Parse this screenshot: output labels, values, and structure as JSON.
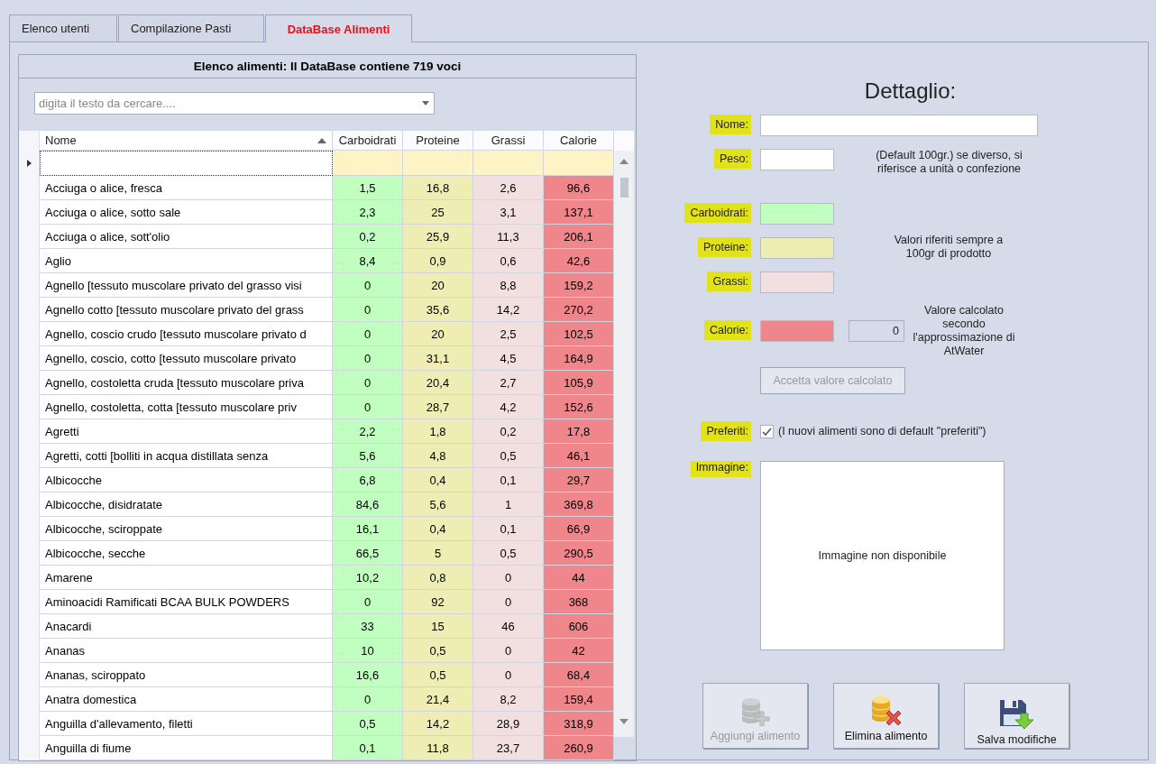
{
  "tabs": [
    {
      "label": "Elenco utenti",
      "selected": false
    },
    {
      "label": "Compilazione Pasti",
      "selected": false
    },
    {
      "label": "DataBase Alimenti",
      "selected": true
    }
  ],
  "list_panel": {
    "title": "Elenco alimenti:  Il DataBase contiene 719 voci",
    "search": {
      "placeholder": "digita il testo da cercare...."
    },
    "table": {
      "columns": [
        {
          "label": "Nome",
          "sorted": true
        },
        {
          "label": "Carboidrati",
          "color": "#c0ffc0"
        },
        {
          "label": "Proteine",
          "color": "#eeeeb4"
        },
        {
          "label": "Grassi",
          "color": "#f2dfe0"
        },
        {
          "label": "Calorie",
          "color": "#ee868c"
        }
      ],
      "new_row": {
        "current": true
      },
      "rows": [
        [
          "Acciuga o alice, fresca",
          "1,5",
          "16,8",
          "2,6",
          "96,6"
        ],
        [
          "Acciuga o alice, sotto sale",
          "2,3",
          "25",
          "3,1",
          "137,1"
        ],
        [
          "Acciuga o alice, sott'olio",
          "0,2",
          "25,9",
          "11,3",
          "206,1"
        ],
        [
          "Aglio",
          "8,4",
          "0,9",
          "0,6",
          "42,6"
        ],
        [
          "Agnello [tessuto muscolare privato del grasso visi",
          "0",
          "20",
          "8,8",
          "159,2"
        ],
        [
          "Agnello cotto [tessuto muscolare privato del grass",
          "0",
          "35,6",
          "14,2",
          "270,2"
        ],
        [
          "Agnello, coscio crudo [tessuto muscolare privato d",
          "0",
          "20",
          "2,5",
          "102,5"
        ],
        [
          "Agnello, coscio, cotto [tessuto muscolare privato",
          "0",
          "31,1",
          "4,5",
          "164,9"
        ],
        [
          "Agnello, costoletta cruda [tessuto muscolare priva",
          "0",
          "20,4",
          "2,7",
          "105,9"
        ],
        [
          "Agnello, costoletta, cotta [tessuto muscolare priv",
          "0",
          "28,7",
          "4,2",
          "152,6"
        ],
        [
          "Agretti",
          "2,2",
          "1,8",
          "0,2",
          "17,8"
        ],
        [
          "Agretti, cotti [bolliti in acqua distillata senza",
          "5,6",
          "4,8",
          "0,5",
          "46,1"
        ],
        [
          "Albicocche",
          "6,8",
          "0,4",
          "0,1",
          "29,7"
        ],
        [
          "Albicocche, disidratate",
          "84,6",
          "5,6",
          "1",
          "369,8"
        ],
        [
          "Albicocche, sciroppate",
          "16,1",
          "0,4",
          "0,1",
          "66,9"
        ],
        [
          "Albicocche, secche",
          "66,5",
          "5",
          "0,5",
          "290,5"
        ],
        [
          "Amarene",
          "10,2",
          "0,8",
          "0",
          "44"
        ],
        [
          "Aminoacidi Ramificati BCAA BULK POWDERS",
          "0",
          "92",
          "0",
          "368"
        ],
        [
          "Anacardi",
          "33",
          "15",
          "46",
          "606"
        ],
        [
          "Ananas",
          "10",
          "0,5",
          "0",
          "42"
        ],
        [
          "Ananas, sciroppato",
          "16,6",
          "0,5",
          "0",
          "68,4"
        ],
        [
          "Anatra domestica",
          "0",
          "21,4",
          "8,2",
          "159,4"
        ],
        [
          "Anguilla d'allevamento, filetti",
          "0,5",
          "14,2",
          "28,9",
          "318,9"
        ],
        [
          "Anguilla di fiume",
          "0,1",
          "11,8",
          "23,7",
          "260,9"
        ]
      ]
    }
  },
  "detail": {
    "title": "Dettaglio:",
    "fields": [
      {
        "kind": "wide",
        "label": "Nome:",
        "highlighted": true
      },
      {
        "kind": "short",
        "label": "Peso:",
        "highlighted": true,
        "note": "(Default 100gr.) se diverso, si riferisce a unità o confezione"
      },
      {
        "kind": "short",
        "label": "Carboidrati:",
        "highlighted": true,
        "color": "#c0ffc0"
      },
      {
        "kind": "short",
        "label": "Proteine:",
        "highlighted": true,
        "color": "#eeeeb4",
        "note": "Valori riferiti sempre a 100gr di prodotto"
      },
      {
        "kind": "short",
        "label": "Grassi:",
        "highlighted": true,
        "color": "#f2dfe0"
      },
      {
        "kind": "calc",
        "label": "Calorie:",
        "highlighted": true,
        "color": "#ee868c",
        "calculated": "0",
        "note": "Valore calcolato secondo l'approssimazione di AtWater",
        "button": {
          "label": "Accetta valore calcolato",
          "disabled": true
        }
      }
    ],
    "favorites": {
      "label": "Preferiti:",
      "highlighted": true,
      "checked": true,
      "caption": "(I nuovi alimenti sono di default \"preferiti\")"
    },
    "image": {
      "label": "Immagine:",
      "highlighted": true,
      "text": "Immagine non disponibile"
    },
    "buttons": [
      {
        "kind": "add",
        "label": "Aggiungi alimento",
        "disabled": true
      },
      {
        "kind": "delete",
        "label": "Elimina alimento",
        "disabled": false
      },
      {
        "kind": "save",
        "label": "Salva modifiche",
        "disabled": false
      }
    ]
  }
}
